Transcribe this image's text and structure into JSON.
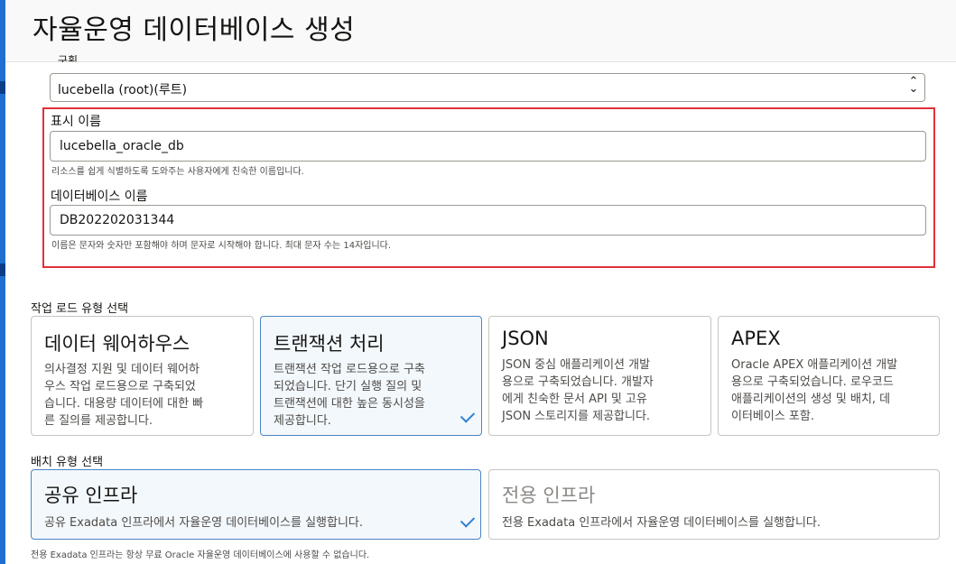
{
  "header": {
    "title": "자율운영 데이터베이스 생성"
  },
  "compartment": {
    "label": "구획",
    "selected_value": "lucebella (root)(루트)",
    "arrow_up": "⌃",
    "arrow_down": "⌄"
  },
  "display_name": {
    "label": "표시 이름",
    "value": "lucebella_oracle_db",
    "help": "리소스를 쉽게 식별하도록 도와주는 사용자에게 친숙한 이름입니다."
  },
  "database_name": {
    "label": "데이터베이스 이름",
    "value": "DB202202031344",
    "help": "이름은 문자와 숫자만 포함해야 하며 문자로 시작해야 합니다. 최대 문자 수는 14자입니다."
  },
  "workload": {
    "label": "작업 로드 유형 선택",
    "cards": [
      {
        "title": "데이터 웨어하우스",
        "desc": [
          "의사결정 지원 및 데이터 웨어하",
          "우스 작업 로드용으로 구축되었",
          "습니다. 대용량 데이터에 대한 빠",
          "른 질의를 제공합니다."
        ]
      },
      {
        "title": "트랜잭션 처리",
        "desc": [
          "트랜잭션 작업 로드용으로 구축",
          "되었습니다. 단기 실행 질의 및",
          "트랜잭션에 대한 높은 동시성을",
          "제공합니다."
        ]
      },
      {
        "title": "JSON",
        "desc": [
          "JSON 중심 애플리케이션 개발",
          "용으로 구축되었습니다. 개발자",
          "에게 친숙한 문서 API 및 고유",
          "JSON 스토리지를 제공합니다."
        ]
      },
      {
        "title": "APEX",
        "desc": [
          "Oracle APEX 애플리케이션 개발",
          "용으로 구축되었습니다. 로우코드",
          "애플리케이션의 생성 및 배치, 데",
          "이터베이스 포함."
        ]
      }
    ]
  },
  "deployment": {
    "label": "배치 유형 선택",
    "cards": [
      {
        "title": "공유 인프라",
        "desc": "공유 Exadata 인프라에서 자율운영 데이터베이스를 실행합니다."
      },
      {
        "title": "전용 인프라",
        "desc": "전용 Exadata 인프라에서 자율운영 데이터베이스를 실행합니다."
      }
    ],
    "footnote": "전용 Exadata 인프라는 항상 무료 Oracle 자율운영 데이터베이스에 사용할 수 없습니다."
  }
}
